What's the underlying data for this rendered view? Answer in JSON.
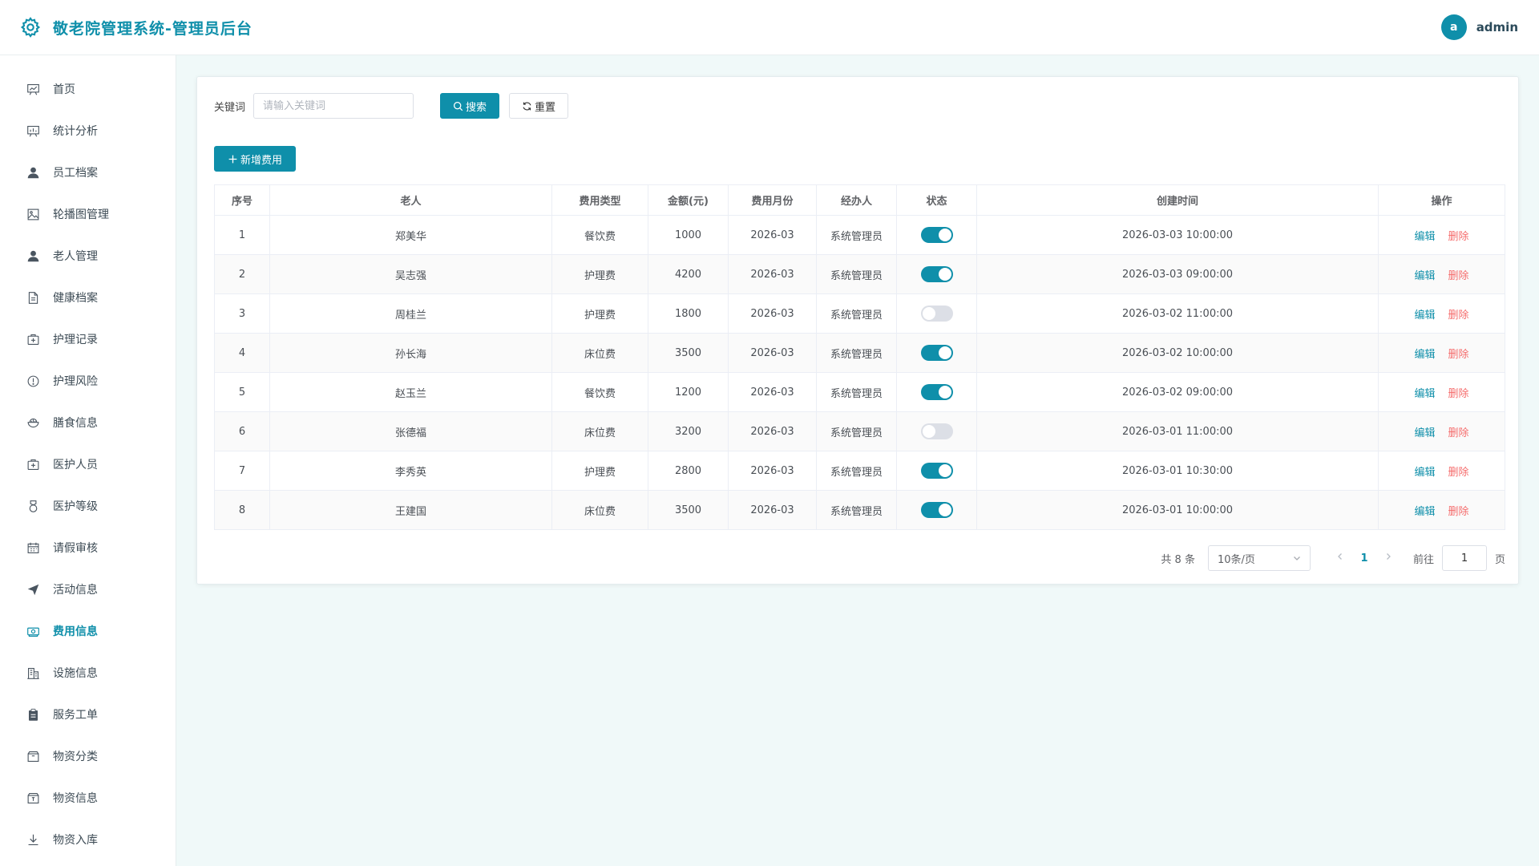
{
  "header": {
    "title": "敬老院管理系统-管理员后台",
    "avatar_letter": "a",
    "username": "admin"
  },
  "sidebar": {
    "items": [
      {
        "id": "home",
        "label": "首页",
        "icon": "board-icon"
      },
      {
        "id": "stats",
        "label": "统计分析",
        "icon": "chart-board-icon"
      },
      {
        "id": "staff",
        "label": "员工档案",
        "icon": "user-icon"
      },
      {
        "id": "carousel",
        "label": "轮播图管理",
        "icon": "image-icon"
      },
      {
        "id": "elder",
        "label": "老人管理",
        "icon": "user-icon"
      },
      {
        "id": "health",
        "label": "健康档案",
        "icon": "document-icon"
      },
      {
        "id": "care-record",
        "label": "护理记录",
        "icon": "first-aid-icon"
      },
      {
        "id": "care-risk",
        "label": "护理风险",
        "icon": "warning-circle-icon"
      },
      {
        "id": "meal",
        "label": "膳食信息",
        "icon": "bowl-icon"
      },
      {
        "id": "medical-staff",
        "label": "医护人员",
        "icon": "first-aid-icon"
      },
      {
        "id": "medical-level",
        "label": "医护等级",
        "icon": "medal-icon"
      },
      {
        "id": "leave",
        "label": "请假审核",
        "icon": "calendar-icon"
      },
      {
        "id": "activity",
        "label": "活动信息",
        "icon": "send-icon"
      },
      {
        "id": "fee",
        "label": "费用信息",
        "icon": "money-icon",
        "active": true
      },
      {
        "id": "facility",
        "label": "设施信息",
        "icon": "building-icon"
      },
      {
        "id": "work-order",
        "label": "服务工单",
        "icon": "clipboard-icon"
      },
      {
        "id": "goods-category",
        "label": "物资分类",
        "icon": "box-icon"
      },
      {
        "id": "goods",
        "label": "物资信息",
        "icon": "box-icon"
      },
      {
        "id": "stock-in",
        "label": "物资入库",
        "icon": "download-icon"
      }
    ]
  },
  "filter": {
    "keyword_label": "关键词",
    "keyword_value": "",
    "keyword_placeholder": "请输入关键词",
    "search_label": "搜索",
    "reset_label": "重置",
    "add_label": "新增费用"
  },
  "table": {
    "columns": [
      "序号",
      "老人",
      "费用类型",
      "金额(元)",
      "费用月份",
      "经办人",
      "状态",
      "创建时间",
      "操作"
    ],
    "rows": [
      {
        "index": "1",
        "elder": "郑美华",
        "type": "餐饮费",
        "amount": "1000",
        "month": "2026-03",
        "handler": "系统管理员",
        "status": true,
        "created": "2026-03-03 10:00:00"
      },
      {
        "index": "2",
        "elder": "吴志强",
        "type": "护理费",
        "amount": "4200",
        "month": "2026-03",
        "handler": "系统管理员",
        "status": true,
        "created": "2026-03-03 09:00:00"
      },
      {
        "index": "3",
        "elder": "周桂兰",
        "type": "护理费",
        "amount": "1800",
        "month": "2026-03",
        "handler": "系统管理员",
        "status": false,
        "created": "2026-03-02 11:00:00"
      },
      {
        "index": "4",
        "elder": "孙长海",
        "type": "床位费",
        "amount": "3500",
        "month": "2026-03",
        "handler": "系统管理员",
        "status": true,
        "created": "2026-03-02 10:00:00"
      },
      {
        "index": "5",
        "elder": "赵玉兰",
        "type": "餐饮费",
        "amount": "1200",
        "month": "2026-03",
        "handler": "系统管理员",
        "status": true,
        "created": "2026-03-02 09:00:00"
      },
      {
        "index": "6",
        "elder": "张德福",
        "type": "床位费",
        "amount": "3200",
        "month": "2026-03",
        "handler": "系统管理员",
        "status": false,
        "created": "2026-03-01 11:00:00"
      },
      {
        "index": "7",
        "elder": "李秀英",
        "type": "护理费",
        "amount": "2800",
        "month": "2026-03",
        "handler": "系统管理员",
        "status": true,
        "created": "2026-03-01 10:30:00"
      },
      {
        "index": "8",
        "elder": "王建国",
        "type": "床位费",
        "amount": "3500",
        "month": "2026-03",
        "handler": "系统管理员",
        "status": true,
        "created": "2026-03-01 10:00:00"
      }
    ],
    "edit_label": "编辑",
    "delete_label": "删除"
  },
  "pagination": {
    "total_text": "共 8 条",
    "page_size": "10条/页",
    "current_page": "1",
    "goto_label": "前往",
    "goto_value": "1",
    "goto_suffix": "页"
  },
  "colors": {
    "accent": "#0f8faa",
    "danger": "#f56c6c"
  }
}
